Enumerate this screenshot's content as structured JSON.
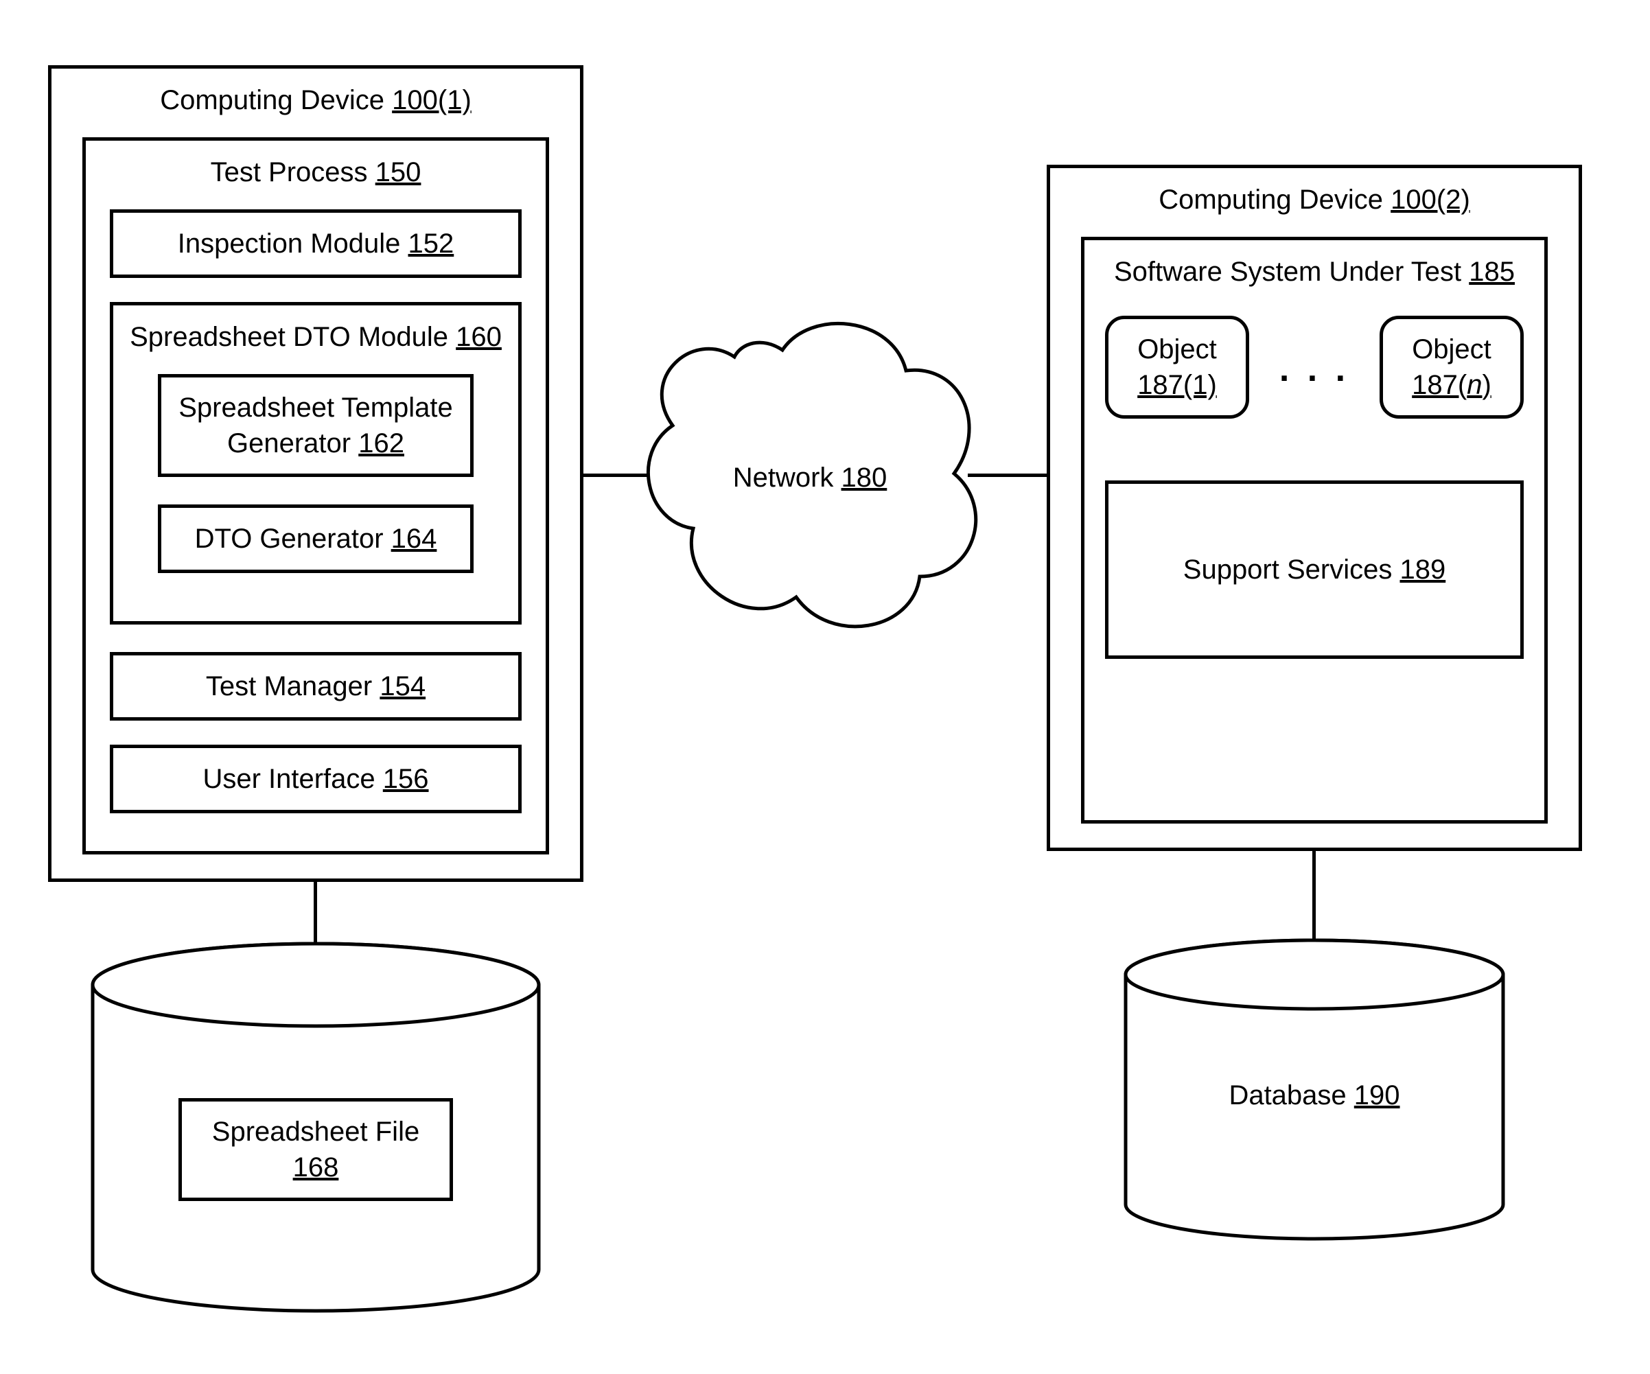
{
  "device1": {
    "title_text": "Computing Device",
    "title_ref": "100(1)",
    "test_process": {
      "text": "Test Process",
      "ref": "150"
    },
    "inspection_module": {
      "text": "Inspection Module",
      "ref": "152"
    },
    "dto_module": {
      "text": "Spreadsheet DTO Module",
      "ref": "160"
    },
    "template_generator": {
      "text_line1": "Spreadsheet Template",
      "text_line2": "Generator",
      "ref": "162"
    },
    "dto_generator": {
      "text": "DTO Generator",
      "ref": "164"
    },
    "test_manager": {
      "text": "Test Manager",
      "ref": "154"
    },
    "user_interface": {
      "text": "User Interface",
      "ref": "156"
    }
  },
  "spreadsheet_file": {
    "text": "Spreadsheet File",
    "ref": "168"
  },
  "network": {
    "text": "Network",
    "ref": "180"
  },
  "device2": {
    "title_text": "Computing Device",
    "title_ref": "100(2)",
    "sut": {
      "text": "Software System Under Test",
      "ref": "185"
    },
    "object_first": {
      "text": "Object",
      "ref": "187(1)"
    },
    "object_last": {
      "text": "Object",
      "ref_prefix": "187(",
      "ref_n": "n",
      "ref_suffix": ")"
    },
    "ellipsis": ".  .  .",
    "support_services": {
      "text": "Support Services",
      "ref": "189"
    }
  },
  "database": {
    "text": "Database",
    "ref": "190"
  }
}
